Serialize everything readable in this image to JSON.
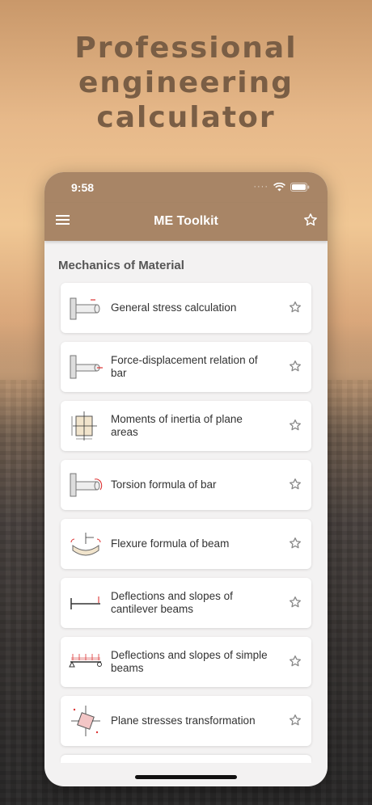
{
  "promo": {
    "headline_lines": [
      "Professional",
      "engineering",
      "calculator"
    ]
  },
  "status_bar": {
    "time": "9:58"
  },
  "app_bar": {
    "title": "ME Toolkit",
    "menu_icon": "hamburger-menu-icon",
    "action_icon": "star-outline-icon"
  },
  "section": {
    "title": "Mechanics of Material"
  },
  "items": [
    {
      "label": "General stress calculation",
      "icon": "cantilever-bar-icon"
    },
    {
      "label": "Force-displacement relation of bar",
      "icon": "bar-axial-force-icon"
    },
    {
      "label": "Moments of inertia of plane areas",
      "icon": "rectangle-section-icon"
    },
    {
      "label": "Torsion formula of bar",
      "icon": "bar-torsion-icon"
    },
    {
      "label": "Flexure formula of beam",
      "icon": "beam-bending-icon"
    },
    {
      "label": "Deflections and slopes of cantilever beams",
      "icon": "cantilever-beam-icon"
    },
    {
      "label": "Deflections and slopes of simple beams",
      "icon": "simple-beam-icon"
    },
    {
      "label": "Plane stresses transformation",
      "icon": "stress-element-icon"
    }
  ],
  "colors": {
    "app_bar": "#a88566",
    "headline": "#7a5e45",
    "background_list": "#f3f2f2"
  }
}
